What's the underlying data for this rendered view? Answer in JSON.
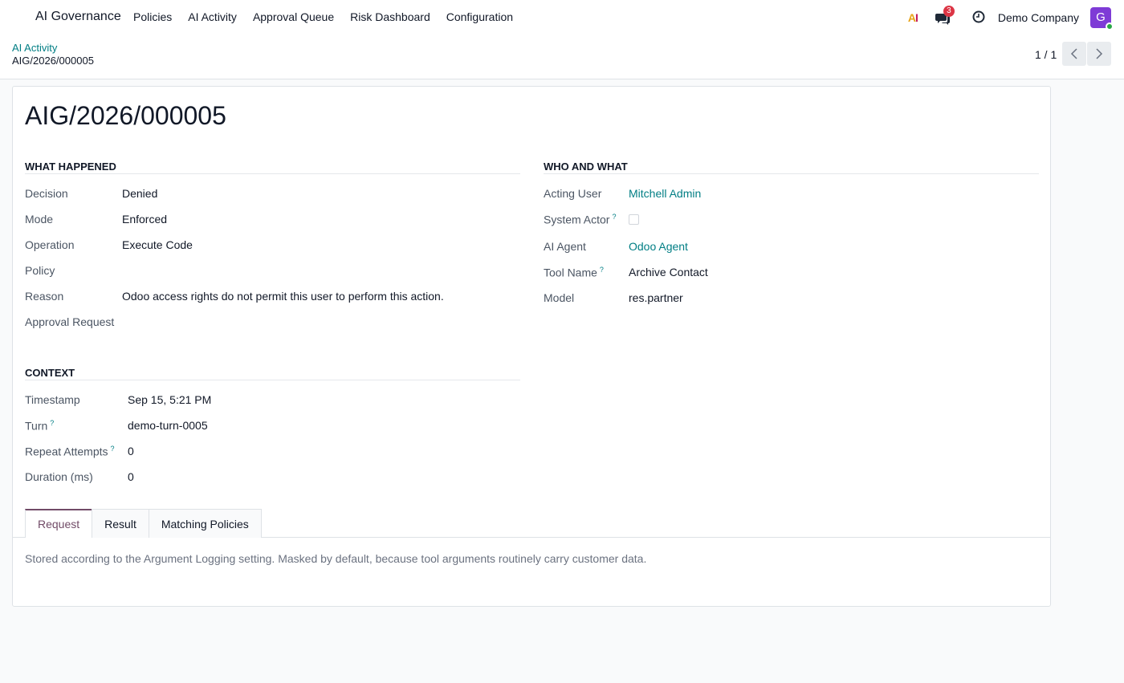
{
  "navbar": {
    "brand": "AI Governance",
    "menu": [
      "Policies",
      "AI Activity",
      "Approval Queue",
      "Risk Dashboard",
      "Configuration"
    ],
    "ai_icon_a": "A",
    "ai_icon_i": "I",
    "messages_count": "3",
    "company": "Demo Company",
    "avatar_initial": "G"
  },
  "breadcrumb": {
    "parent": "AI Activity",
    "current": "AIG/2026/000005"
  },
  "pager": {
    "value": "1 / 1"
  },
  "record": {
    "title": "AIG/2026/000005",
    "what_happened": {
      "title": "WHAT HAPPENED",
      "fields": [
        {
          "label": "Decision",
          "value": "Denied"
        },
        {
          "label": "Mode",
          "value": "Enforced"
        },
        {
          "label": "Operation",
          "value": "Execute Code"
        },
        {
          "label": "Policy",
          "value": ""
        },
        {
          "label": "Reason",
          "value": "Odoo access rights do not permit this user to perform this action."
        },
        {
          "label": "Approval Request",
          "value": ""
        }
      ]
    },
    "who_and_what": {
      "title": "WHO AND WHAT",
      "fields": [
        {
          "label": "Acting User",
          "value": "Mitchell Admin"
        },
        {
          "label": "System Actor",
          "value": ""
        },
        {
          "label": "AI Agent",
          "value": "Odoo Agent"
        },
        {
          "label": "Tool Name",
          "value": "Archive Contact"
        },
        {
          "label": "Model",
          "value": "res.partner"
        }
      ]
    },
    "context": {
      "title": "CONTEXT",
      "fields": [
        {
          "label": "Timestamp",
          "value": "Sep 15, 5:21 PM"
        },
        {
          "label": "Turn",
          "value": "demo-turn-0005"
        },
        {
          "label": "Repeat Attempts",
          "value": "0"
        },
        {
          "label": "Duration (ms)",
          "value": "0"
        }
      ]
    },
    "help_marker": "?"
  },
  "notebook": {
    "tabs": [
      "Request",
      "Result",
      "Matching Policies"
    ],
    "active_tab": "Request",
    "content": "Stored according to the Argument Logging setting. Masked by default, because tool arguments routinely carry customer data."
  },
  "colors": {
    "link": "#017e84",
    "active_tab": "#714b67",
    "badge": "#dc3545",
    "avatar": "#7e3bd6"
  }
}
